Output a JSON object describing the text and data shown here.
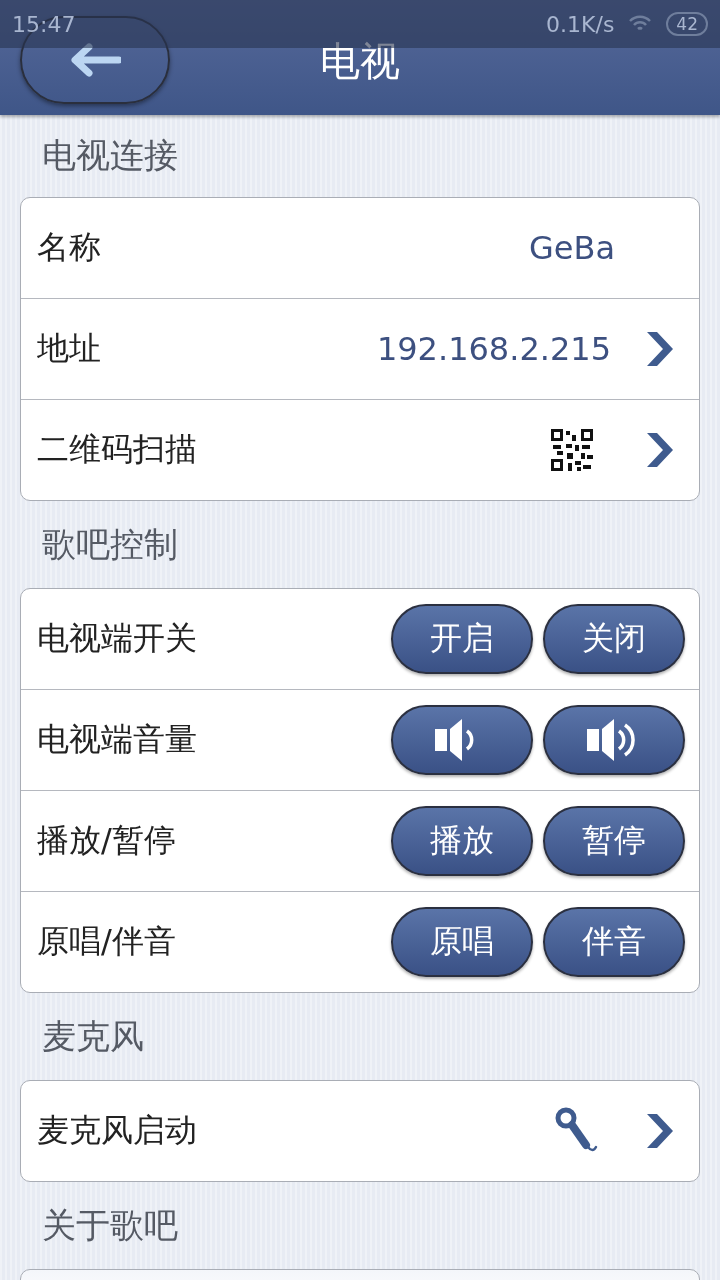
{
  "status_bar": {
    "time": "15:47",
    "speed": "0.1K/s",
    "battery": "42"
  },
  "header": {
    "title": "电视"
  },
  "sections": [
    {
      "title": "电视连接",
      "rows": [
        {
          "kind": "value",
          "label": "名称",
          "value": "GeBa"
        },
        {
          "kind": "value_link",
          "label": "地址",
          "value": "192.168.2.215"
        },
        {
          "kind": "qr_link",
          "label": "二维码扫描"
        }
      ]
    },
    {
      "title": "歌吧控制",
      "rows": [
        {
          "kind": "buttons",
          "label": "电视端开关",
          "buttons": [
            {
              "kind": "text",
              "label": "开启"
            },
            {
              "kind": "text",
              "label": "关闭"
            }
          ]
        },
        {
          "kind": "buttons",
          "label": "电视端音量",
          "buttons": [
            {
              "kind": "volume_down"
            },
            {
              "kind": "volume_up"
            }
          ]
        },
        {
          "kind": "buttons",
          "label": "播放/暂停",
          "buttons": [
            {
              "kind": "text",
              "label": "播放"
            },
            {
              "kind": "text",
              "label": "暂停"
            }
          ]
        },
        {
          "kind": "buttons",
          "label": "原唱/伴音",
          "buttons": [
            {
              "kind": "text",
              "label": "原唱"
            },
            {
              "kind": "text",
              "label": "伴音"
            }
          ]
        }
      ]
    },
    {
      "title": "麦克风",
      "rows": [
        {
          "kind": "mic_link",
          "label": "麦克风启动"
        }
      ]
    },
    {
      "title": "关于歌吧"
    }
  ]
}
